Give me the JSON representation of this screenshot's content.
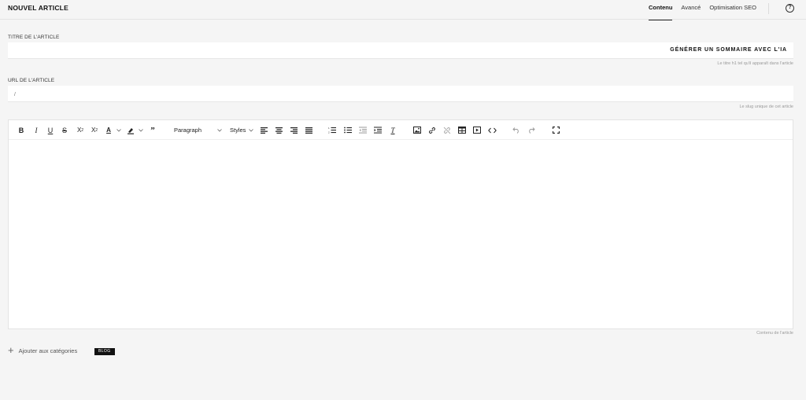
{
  "header": {
    "title": "NOUVEL ARTICLE",
    "tabs": [
      {
        "label": "Contenu",
        "active": true
      },
      {
        "label": "Avancé",
        "active": false
      },
      {
        "label": "Optimisation SEO",
        "active": false
      }
    ],
    "help_icon": "?"
  },
  "title_field": {
    "label": "TITRE DE L'ARTICLE",
    "value": "",
    "ai_button": "GÉNÉRER UN SOMMAIRE AVEC L'IA",
    "hint": "Le titre h1 tel qu'il apparaît dans l'article"
  },
  "url_field": {
    "label": "URL DE L'ARTICLE",
    "value": "/",
    "hint": "Le slug unique de cet article"
  },
  "editor": {
    "paragraph_select": "Paragraph",
    "styles_select": "Styles",
    "hint": "Contenu de l'article",
    "icons": [
      "bold-icon",
      "italic-icon",
      "underline-icon",
      "strikethrough-icon",
      "superscript-icon",
      "subscript-icon",
      "text-color-icon",
      "highlight-icon",
      "blockquote-icon",
      "align-left-icon",
      "align-center-icon",
      "align-right-icon",
      "align-justify-icon",
      "ordered-list-icon",
      "bullet-list-icon",
      "outdent-icon",
      "indent-icon",
      "clear-format-icon",
      "image-icon",
      "link-icon",
      "unlink-icon",
      "table-icon",
      "video-icon",
      "code-icon",
      "undo-icon",
      "redo-icon",
      "fullscreen-icon"
    ]
  },
  "categories": {
    "add_label": "Ajouter aux catégories",
    "tags": [
      "BLOG"
    ]
  },
  "colors": {
    "background": "#f5f5f5",
    "surface": "#ffffff",
    "text": "#222222",
    "tag_bg": "#111111"
  }
}
